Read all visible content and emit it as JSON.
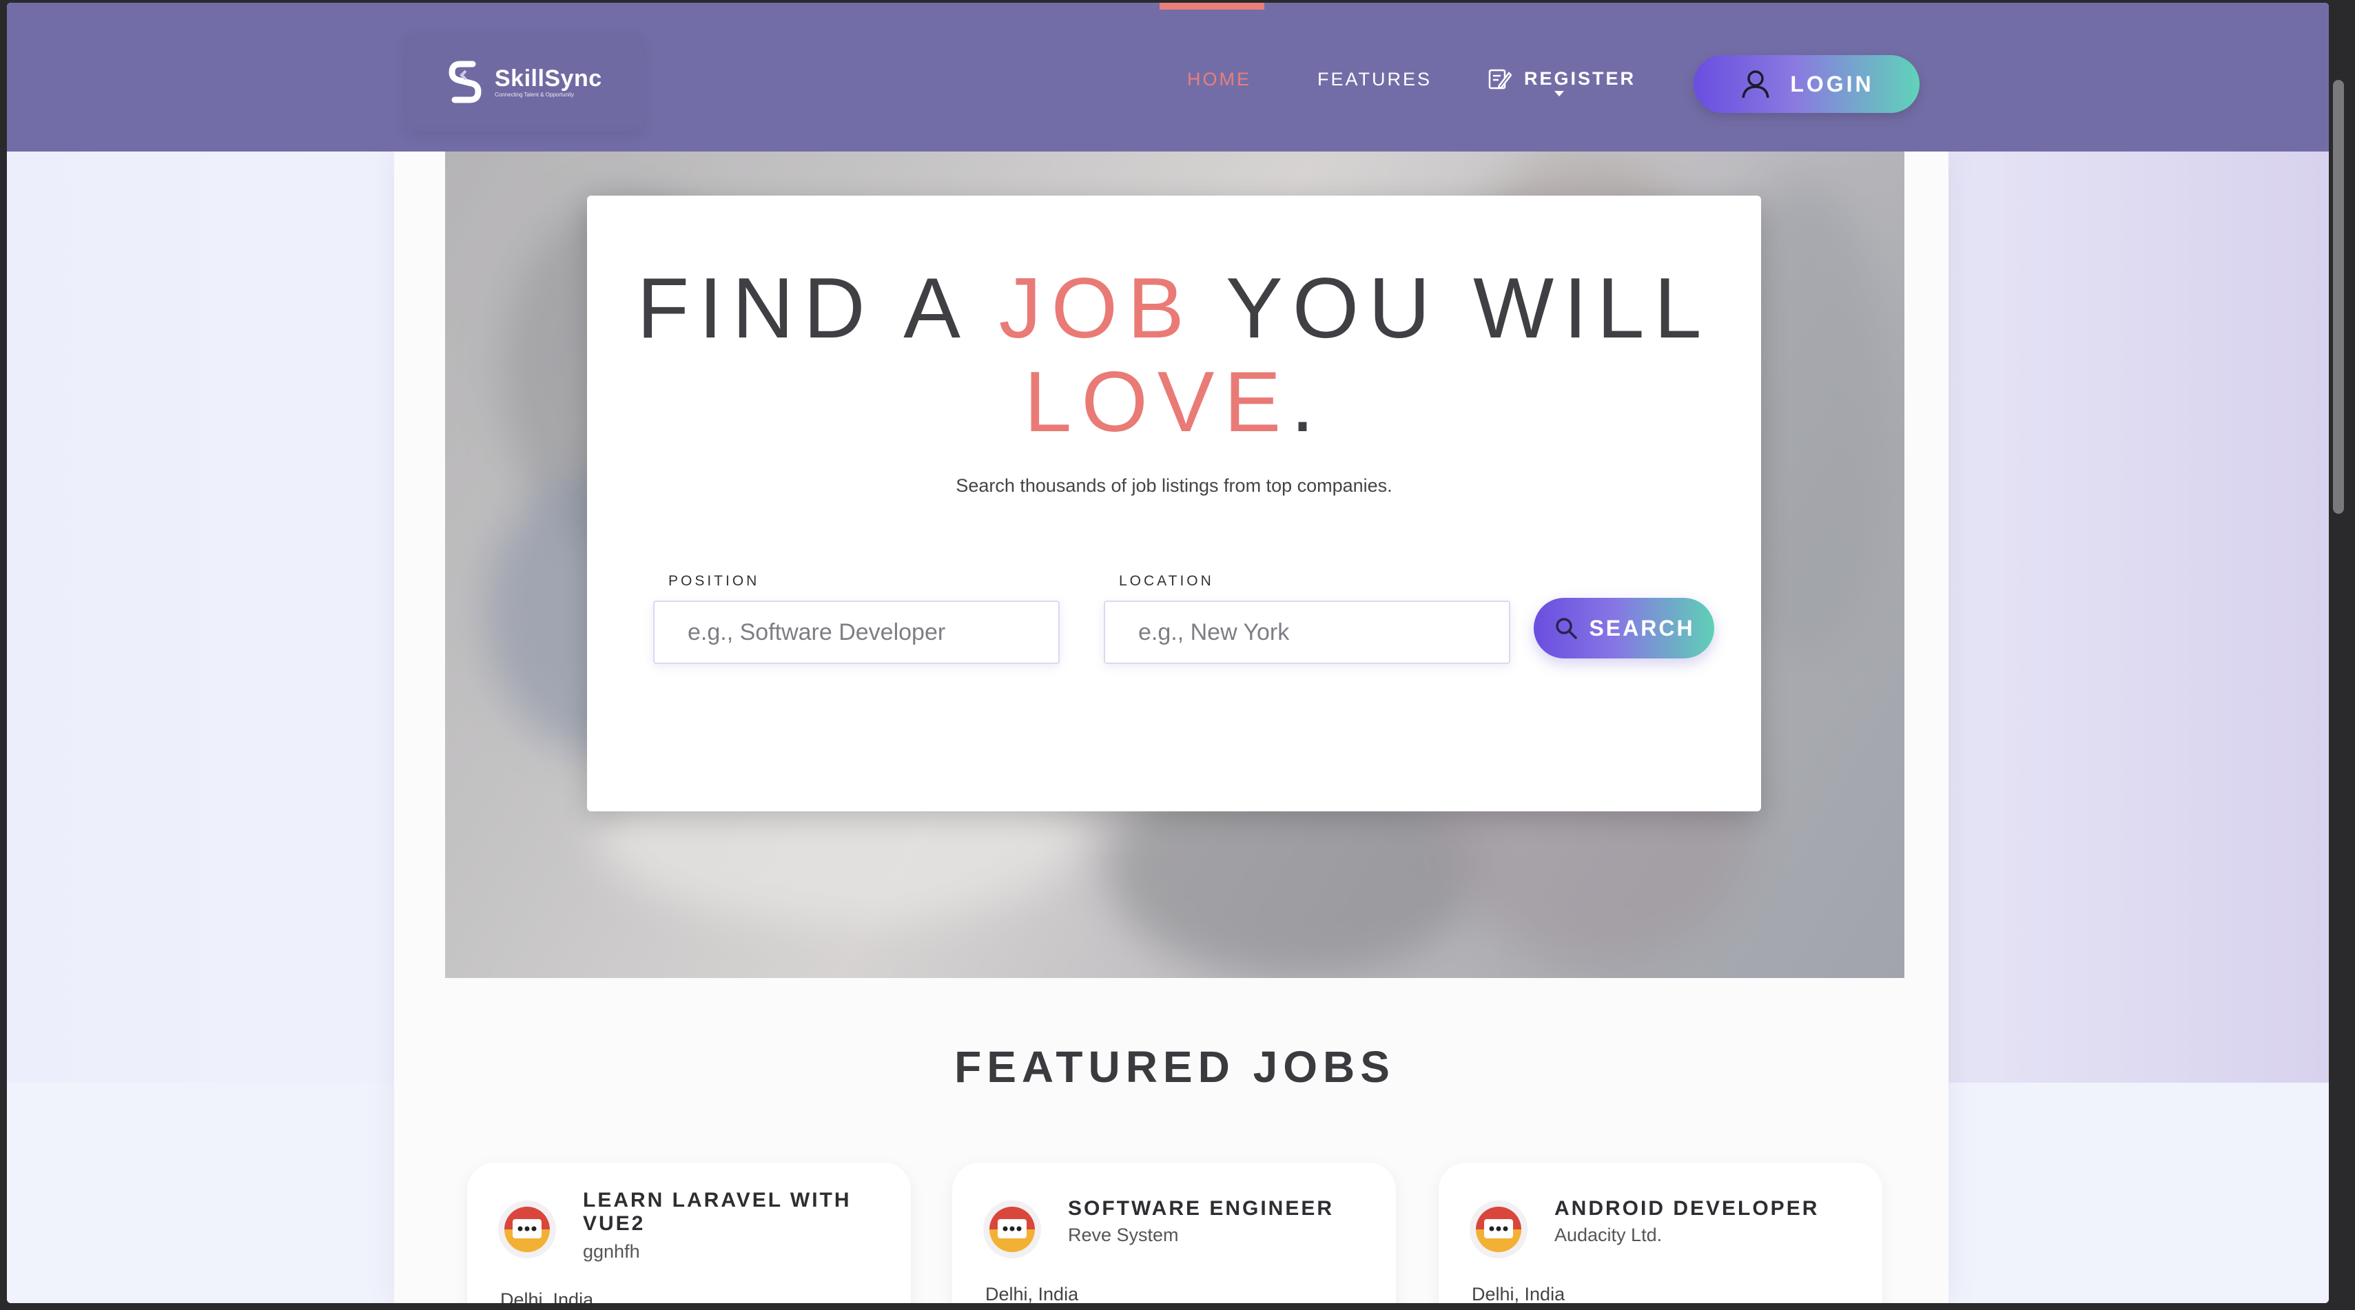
{
  "brand": {
    "name": "SkillSync",
    "tagline": "Connecting Talent & Opportunity"
  },
  "nav": {
    "home": "HOME",
    "features": "FEATURES",
    "register": "REGISTER",
    "login": "LOGIN"
  },
  "hero": {
    "headline_part1": "FIND A ",
    "headline_accent1": "JOB",
    "headline_part2": " YOU WILL",
    "headline_accent2": "LOVE",
    "headline_end": ".",
    "subheading": "Search thousands of job listings from top companies."
  },
  "search": {
    "position_label": "POSITION",
    "position_placeholder": "e.g., Software Developer",
    "location_label": "LOCATION",
    "location_placeholder": "e.g., New York",
    "button_label": "SEARCH"
  },
  "featured": {
    "title": "FEATURED JOBS",
    "jobs": [
      {
        "title": "LEARN LARAVEL WITH VUE2",
        "company": "ggnhfh",
        "location": "Delhi, India"
      },
      {
        "title": "SOFTWARE ENGINEER",
        "company": "Reve System",
        "location": "Delhi, India"
      },
      {
        "title": "ANDROID DEVELOPER",
        "company": "Audacity Ltd.",
        "location": "Delhi, India"
      }
    ]
  },
  "colors": {
    "navbar": "#736da7",
    "accent": "#e97a76",
    "gradient_start": "#6a4ee0",
    "gradient_end": "#5fd3b9"
  },
  "icons": [
    "skillsync-logo-icon",
    "register-icon",
    "user-icon",
    "search-icon",
    "company-logo-icon"
  ]
}
